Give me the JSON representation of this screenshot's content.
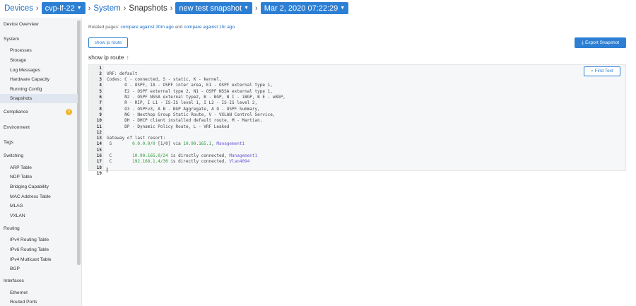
{
  "breadcrumb": {
    "devices": "Devices",
    "device": "cvp-lf-22",
    "system": "System",
    "snapshots": "Snapshots",
    "snapshot_name": "new test snapshot",
    "timestamp": "Mar 2, 2020 07:22:29"
  },
  "sidebar": {
    "device_overview": "Device Overview",
    "system": "System",
    "system_items": [
      "Processes",
      "Storage",
      "Log Messages",
      "Hardware Capacity",
      "Running Config",
      "Snapshots"
    ],
    "compliance": "Compliance",
    "compliance_count": "3",
    "environment": "Environment",
    "tags": "Tags",
    "switching": "Switching",
    "switching_items": [
      "ARP Table",
      "NDP Table",
      "Bridging Capability",
      "MAC Address Table",
      "MLAG",
      "VXLAN"
    ],
    "routing": "Routing",
    "routing_items": [
      "IPv4 Routing Table",
      "IPv6 Routing Table",
      "IPv4 Multicast Table",
      "BGP"
    ],
    "interfaces": "Interfaces",
    "interfaces_items": [
      "Ethernet",
      "Routed Ports"
    ]
  },
  "main": {
    "related_prefix": "Related pages:",
    "related_link1": "compare against 30m ago",
    "related_and": "and",
    "related_link2": "compare against 1hr ago",
    "command_button": "show ip route",
    "export_button": "Export Snapshot",
    "heading": "show ip route",
    "find_button": "Find Text"
  },
  "code_lines": [
    {
      "n": "1",
      "t": ""
    },
    {
      "n": "2",
      "t": "VRF: default"
    },
    {
      "n": "3",
      "t": "Codes: C - connected, S - static, K - kernel,"
    },
    {
      "n": "4",
      "t": "       O - OSPF, IA - OSPF inter area, E1 - OSPF external type 1,"
    },
    {
      "n": "5",
      "t": "       E2 - OSPF external type 2, N1 - OSPF NSSA external type 1,"
    },
    {
      "n": "6",
      "t": "       N2 - OSPF NSSA external type2, B - BGP, B I - iBGP, B E - eBGP,"
    },
    {
      "n": "7",
      "t": "       R - RIP, I L1 - IS-IS level 1, I L2 - IS-IS level 2,"
    },
    {
      "n": "8",
      "t": "       O3 - OSPFv3, A B - BGP Aggregate, A O - OSPF Summary,"
    },
    {
      "n": "9",
      "t": "       NG - Nexthop Group Static Route, V - VXLAN Control Service,"
    },
    {
      "n": "10",
      "t": "       DH - DHCP client installed default route, M - Martian,"
    },
    {
      "n": "11",
      "t": "       DP - Dynamic Policy Route, L - VRF Leaked"
    },
    {
      "n": "12",
      "t": ""
    },
    {
      "n": "13",
      "t": "Gateway of last resort:"
    },
    {
      "n": "14",
      "pre": " S        ",
      "ip": "0.0.0.0/0",
      "mid": " [1/0] via ",
      "ip2": "10.90.165.1",
      "sep": ", ",
      "if": "Management1"
    },
    {
      "n": "15",
      "t": ""
    },
    {
      "n": "16",
      "pre": " C        ",
      "ip": "10.90.165.0/24",
      "mid": " is directly connected, ",
      "if": "Management1"
    },
    {
      "n": "17",
      "pre": " C        ",
      "ip": "192.168.1.4/30",
      "mid": " is directly connected, ",
      "if": "Vlan4094"
    },
    {
      "n": "18",
      "t": ""
    },
    {
      "n": "19",
      "t": ""
    }
  ]
}
